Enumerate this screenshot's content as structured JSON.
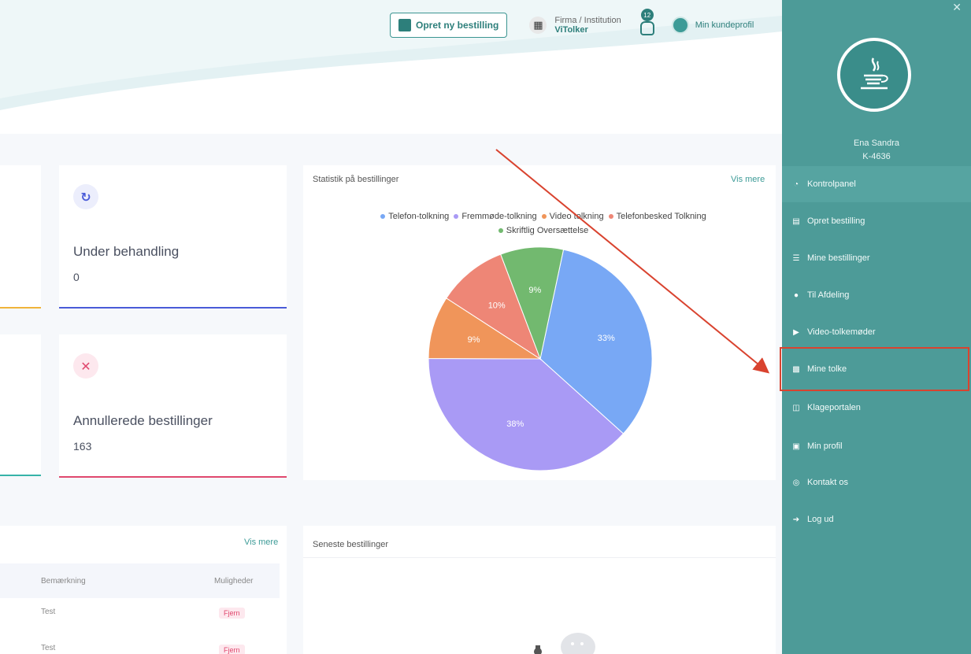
{
  "topbar": {
    "new_order_label": "Opret ny bestilling",
    "firm_label": "Firma / Institution",
    "firm_name": "ViTolker",
    "notification_count": "12",
    "profile_label": "Min kundeprofil"
  },
  "stats": [
    {
      "label": "Under behandling",
      "value": "0",
      "icon": "refresh-icon",
      "color": "#4a5bd8"
    },
    {
      "label": "Annullerede bestillinger",
      "value": "163",
      "icon": "close-icon",
      "color": "#e0486e"
    }
  ],
  "chart_panel": {
    "title": "Statistik på bestillinger",
    "vis_mere": "Vis mere"
  },
  "chart_data": {
    "type": "pie",
    "series": [
      {
        "name": "Telefon-tolkning",
        "value": 33,
        "label": "33%",
        "color": "#78a8f5"
      },
      {
        "name": "Fremmøde-tolkning",
        "value": 38,
        "label": "38%",
        "color": "#a99af5"
      },
      {
        "name": "Video tolkning",
        "value": 9,
        "label": "9%",
        "color": "#f0955a"
      },
      {
        "name": "Telefonbesked Tolkning",
        "value": 10,
        "label": "10%",
        "color": "#ee8676"
      },
      {
        "name": "Skriftlig Oversættelse",
        "value": 9,
        "label": "9%",
        "color": "#72b96f"
      }
    ],
    "legend_placement": "top"
  },
  "orders_left": {
    "vis_mere": "Vis mere",
    "columns": [
      "Bemærkning",
      "Muligheder"
    ],
    "rows": [
      {
        "note": "Test",
        "action": "Fjern"
      },
      {
        "note": "Test",
        "action": "Fjern"
      }
    ]
  },
  "latest_orders": {
    "title": "Seneste bestillinger"
  },
  "sidebar": {
    "user_name": "Ena Sandra",
    "user_id": "K-4636",
    "items": [
      {
        "label": "Kontrolpanel",
        "icon": "dashboard-icon"
      },
      {
        "label": "Opret bestilling",
        "icon": "document-icon"
      },
      {
        "label": "Mine bestillinger",
        "icon": "list-icon"
      },
      {
        "label": "Til Afdeling",
        "icon": "user-icon"
      },
      {
        "label": "Video-tolkemøder",
        "icon": "video-icon"
      },
      {
        "label": "Mine tolke",
        "icon": "id-card-icon"
      },
      {
        "label": "Klageportalen",
        "icon": "gate-icon"
      },
      {
        "label": "Min profil",
        "icon": "profile-icon"
      },
      {
        "label": "Kontakt os",
        "icon": "headset-icon"
      },
      {
        "label": "Log ud",
        "icon": "logout-icon"
      }
    ]
  },
  "colors": {
    "sidebar": "#4d9b98",
    "accent": "#2d7f7b",
    "annotation": "#d9432f"
  }
}
